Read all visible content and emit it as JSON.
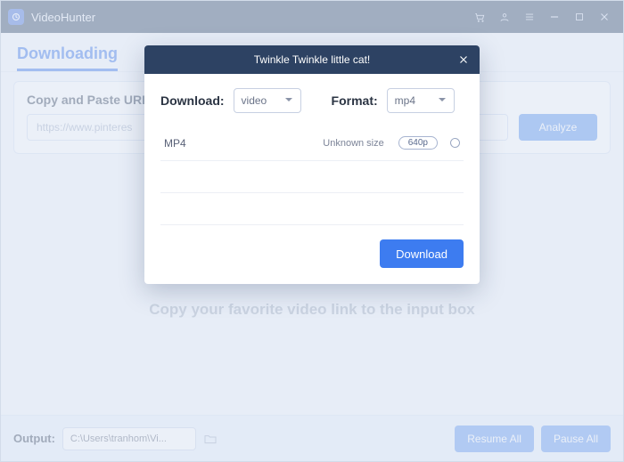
{
  "app": {
    "name": "VideoHunter"
  },
  "tabs": {
    "downloading": "Downloading"
  },
  "panel": {
    "title": "Copy and Paste URL",
    "url_value": "https://www.pinteres",
    "analyze": "Analyze"
  },
  "hint": "Copy your favorite video link to the input box",
  "output": {
    "label": "Output:",
    "path": "C:\\Users\\tranhom\\Vi..."
  },
  "buttons": {
    "resume_all": "Resume All",
    "pause_all": "Pause All"
  },
  "modal": {
    "title": "Twinkle Twinkle little cat!",
    "download_label": "Download:",
    "download_value": "video",
    "format_label": "Format:",
    "format_value": "mp4",
    "row": {
      "format": "MP4",
      "size": "Unknown size",
      "res": "640p"
    },
    "download_btn": "Download"
  }
}
